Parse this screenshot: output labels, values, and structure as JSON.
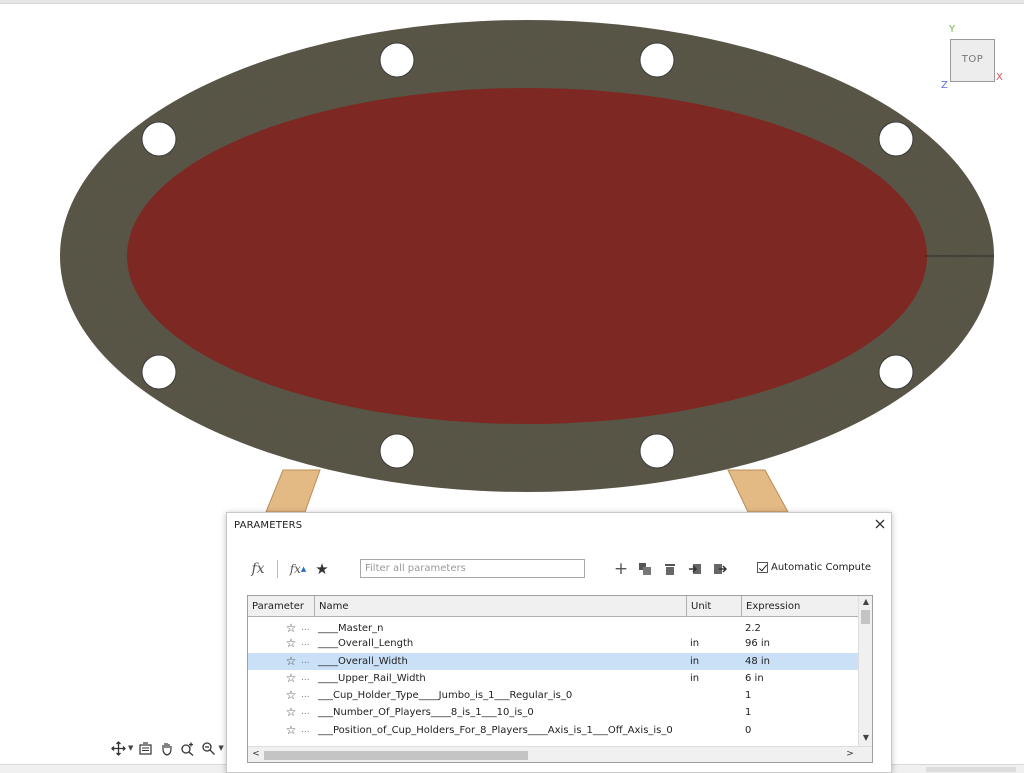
{
  "viewcube": {
    "face_label": "TOP",
    "axis_y": "Y",
    "axis_x": "X",
    "axis_z": "Z"
  },
  "colors": {
    "rail": "#5d5a4c",
    "felt": "#7d2823",
    "leg": "#e3b984",
    "cup_holder": "#ffffff",
    "selection": "#c9e0f6"
  },
  "navbar": {
    "icons": [
      "orbit-icon",
      "look-at-icon",
      "pan-icon",
      "zoom-icon",
      "fit-icon"
    ]
  },
  "dialog": {
    "title": "PARAMETERS",
    "filter_placeholder": "Filter all parameters",
    "auto_compute_label": "Automatic Compute",
    "auto_compute_checked": true,
    "columns": {
      "parameter": "Parameter",
      "name": "Name",
      "unit": "Unit",
      "expression": "Expression"
    },
    "rows": [
      {
        "dots": "...",
        "name": "____Master_n",
        "unit": "",
        "expression": "2.2"
      },
      {
        "dots": "...",
        "name": "____Overall_Length",
        "unit": "in",
        "expression": "96 in"
      },
      {
        "dots": "...",
        "name": "____Overall_Width",
        "unit": "in",
        "expression": "48 in",
        "selected": true
      },
      {
        "dots": "...",
        "name": "____Upper_Rail_Width",
        "unit": "in",
        "expression": "6 in"
      },
      {
        "dots": "...",
        "name": "___Cup_Holder_Type____Jumbo_is_1___Regular_is_0",
        "unit": "",
        "expression": "1"
      },
      {
        "dots": "...",
        "name": "___Number_Of_Players____8_is_1___10_is_0",
        "unit": "",
        "expression": "1"
      },
      {
        "dots": "...",
        "name": "___Position_of_Cup_Holders_For_8_Players____Axis_is_1___Off_Axis_is_0",
        "unit": "",
        "expression": "0"
      }
    ]
  }
}
